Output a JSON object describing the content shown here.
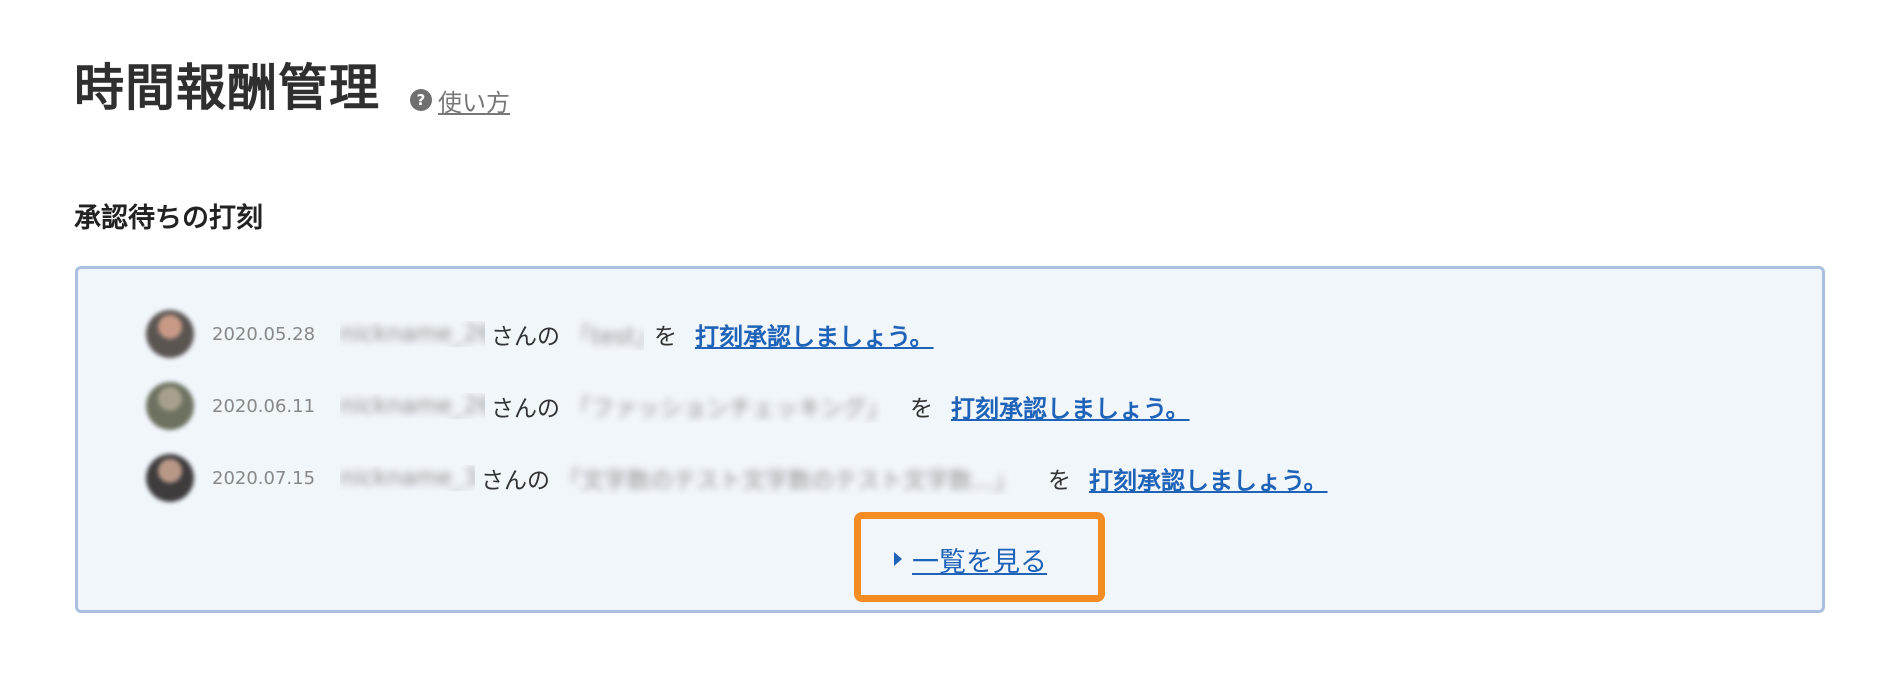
{
  "page": {
    "title": "時間報酬管理",
    "help_link_label": "使い方",
    "help_icon": "question-circle-icon"
  },
  "section": {
    "title": "承認待ちの打刻"
  },
  "pending_stamps": [
    {
      "date": "2020.05.28",
      "nickname": "nickname_26",
      "suffix": "さんの",
      "item_name": "「test」",
      "particle": "を",
      "action_label": "打刻承認しましょう。"
    },
    {
      "date": "2020.06.11",
      "nickname": "nickname_26",
      "suffix": "さんの",
      "item_name": "「ファッションチェッキング」",
      "particle": "を",
      "action_label": "打刻承認しましょう。"
    },
    {
      "date": "2020.07.15",
      "nickname": "nickname_3",
      "suffix": "さんの",
      "item_name": "「文字数のテスト文字数のテスト文字数...」",
      "particle": "を",
      "action_label": "打刻承認しましょう。"
    }
  ],
  "view_all": {
    "label": "一覧を見る",
    "icon": "triangle-right-icon",
    "highlight_color": "#f28c23"
  },
  "colors": {
    "link": "#1f63b8",
    "panel_background": "#f1f6fb",
    "panel_border": "#a9c1df"
  }
}
